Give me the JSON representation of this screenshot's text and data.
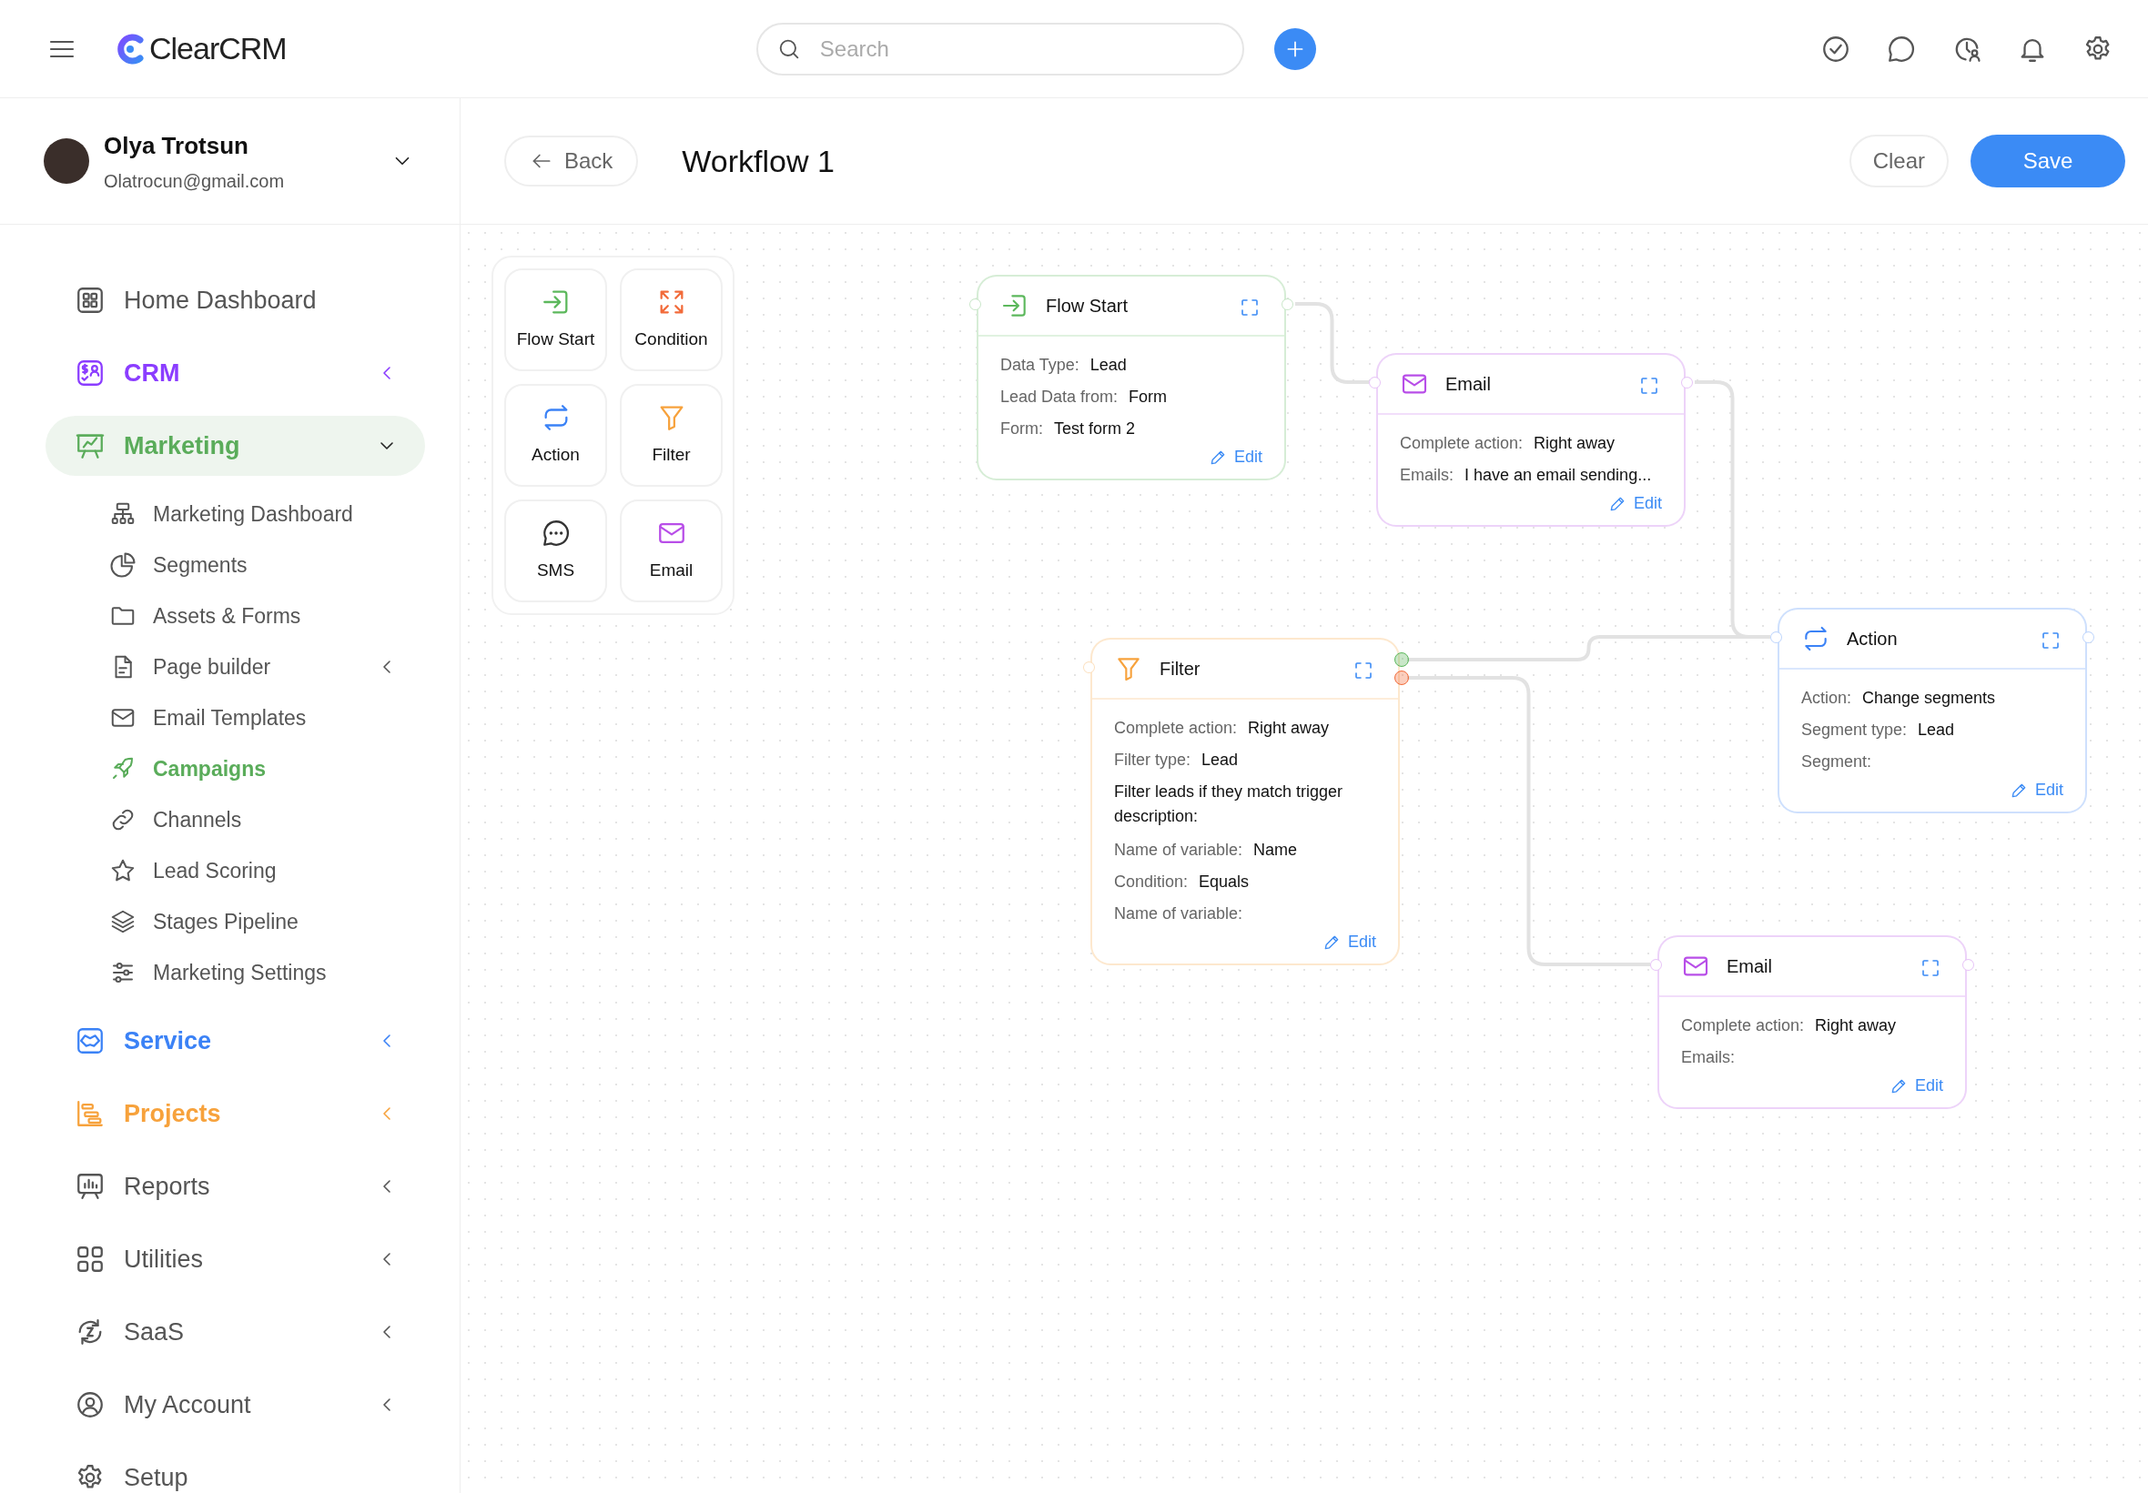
{
  "topbar": {
    "brand": "ClearCRM",
    "search": {
      "placeholder": "Search"
    }
  },
  "user": {
    "name": "Olya Trotsun",
    "email": "Olatrocun@gmail.com"
  },
  "sidebar": {
    "items": [
      {
        "label": "Home Dashboard",
        "kind": "link",
        "color": "#555555",
        "selected": false
      },
      {
        "label": "CRM",
        "kind": "group",
        "color": "#8b3dff",
        "selected": false,
        "expanded": false
      },
      {
        "label": "Marketing",
        "kind": "group",
        "color": "#5aac5a",
        "selected": true,
        "expanded": true,
        "children": [
          {
            "label": "Marketing Dashboard",
            "kind": "link",
            "selected": false
          },
          {
            "label": "Segments",
            "kind": "link",
            "selected": false
          },
          {
            "label": "Assets & Forms",
            "kind": "link",
            "selected": false
          },
          {
            "label": "Page builder",
            "kind": "group",
            "selected": false,
            "expanded": false
          },
          {
            "label": "Email Templates",
            "kind": "link",
            "selected": false
          },
          {
            "label": "Campaigns",
            "kind": "link",
            "selected": true
          },
          {
            "label": "Channels",
            "kind": "link",
            "selected": false
          },
          {
            "label": "Lead Scoring",
            "kind": "link",
            "selected": false
          },
          {
            "label": "Stages Pipeline",
            "kind": "link",
            "selected": false
          },
          {
            "label": "Marketing Settings",
            "kind": "link",
            "selected": false
          }
        ]
      },
      {
        "label": "Service",
        "kind": "group",
        "color": "#3b82f6",
        "selected": false,
        "expanded": false
      },
      {
        "label": "Projects",
        "kind": "group",
        "color": "#f7a23c",
        "selected": false,
        "expanded": false
      },
      {
        "label": "Reports",
        "kind": "group",
        "color": "#555555",
        "selected": false,
        "expanded": false
      },
      {
        "label": "Utilities",
        "kind": "group",
        "color": "#555555",
        "selected": false,
        "expanded": false
      },
      {
        "label": "SaaS",
        "kind": "group",
        "color": "#555555",
        "selected": false,
        "expanded": false
      },
      {
        "label": "My Account",
        "kind": "group",
        "color": "#555555",
        "selected": false,
        "expanded": false
      },
      {
        "label": "Setup",
        "kind": "link",
        "color": "#555555",
        "selected": false
      }
    ]
  },
  "toolbar": {
    "back": "Back",
    "title": "Workflow 1",
    "buttons": [
      {
        "label": "Clear",
        "kind": "secondary"
      },
      {
        "label": "Save",
        "kind": "primary"
      }
    ]
  },
  "palette": [
    {
      "label": "Flow Start",
      "kind": "start"
    },
    {
      "label": "Condition",
      "kind": "condition"
    },
    {
      "label": "Action",
      "kind": "action"
    },
    {
      "label": "Filter",
      "kind": "filter"
    },
    {
      "label": "SMS",
      "kind": "sms"
    },
    {
      "label": "Email",
      "kind": "email"
    }
  ],
  "nodes": [
    {
      "kind": "start",
      "title": "Flow Start",
      "edit": "Edit",
      "rows": [
        {
          "kind": "field",
          "label": "Data Type:",
          "value": "Lead"
        },
        {
          "kind": "field",
          "label": "Lead Data from:",
          "value": "Form"
        },
        {
          "kind": "field",
          "label": "Form:",
          "value": "Test form 2"
        }
      ]
    },
    {
      "kind": "email",
      "title": "Email",
      "edit": "Edit",
      "rows": [
        {
          "kind": "field",
          "label": "Complete action:",
          "value": "Right away"
        },
        {
          "kind": "field",
          "label": "Emails:",
          "value": "I have an email sending..."
        }
      ]
    },
    {
      "kind": "action",
      "title": "Action",
      "edit": "Edit",
      "rows": [
        {
          "kind": "field",
          "label": "Action:",
          "value": "Change segments"
        },
        {
          "kind": "field",
          "label": "Segment type:",
          "value": "Lead"
        },
        {
          "kind": "field",
          "label": "Segment:"
        }
      ]
    },
    {
      "kind": "filter",
      "title": "Filter",
      "edit": "Edit",
      "outputs": [
        {
          "color": "#5cb85c"
        },
        {
          "color": "#f26b3a"
        }
      ],
      "rows": [
        {
          "kind": "field",
          "label": "Complete action:",
          "value": "Right away"
        },
        {
          "kind": "field",
          "label": "Filter type:",
          "value": "Lead"
        },
        {
          "kind": "note",
          "text": "Filter leads if they match trigger description:"
        },
        {
          "kind": "field",
          "label": "Name of variable:",
          "value": "Name"
        },
        {
          "kind": "field",
          "label": "Condition:",
          "value": "Equals"
        },
        {
          "kind": "field",
          "label": "Name of variable:"
        }
      ]
    },
    {
      "kind": "email",
      "title": "Email",
      "edit": "Edit",
      "rows": [
        {
          "kind": "field",
          "label": "Complete action:",
          "value": "Right away"
        },
        {
          "kind": "field",
          "label": "Emails:"
        }
      ]
    }
  ]
}
